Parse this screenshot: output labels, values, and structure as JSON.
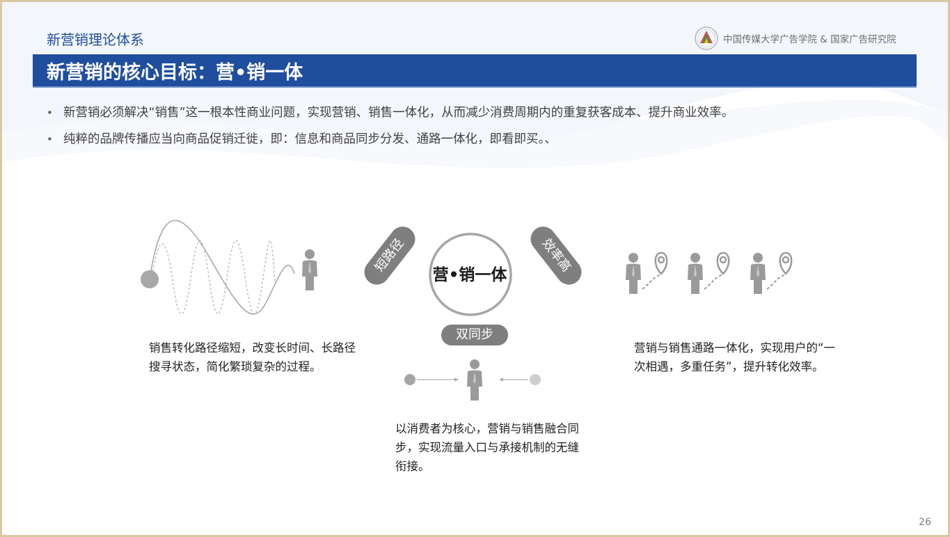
{
  "header": {
    "section_title": "新营销理论体系",
    "org_text": "中国传媒大学广告学院 & 国家广告研究院"
  },
  "title": "新营销的核心目标：营•销一体",
  "bullets": [
    "新营销必须解决“销售”这一根本性商业问题，实现营销、销售一体化，从而减少消费周期内的重复获客成本、提升商业效率。",
    "纯粹的品牌传播应当向商品促销迁徙，即：信息和商品同步分发、通路一体化，即看即买。、"
  ],
  "diagram": {
    "center_label": "营•销一体",
    "pill_left": "短路径",
    "pill_right": "效率高",
    "pill_bottom": "双同步",
    "desc_left": "销售转化路径缩短，改变长时间、长路径搜寻状态，简化繁琐复杂的过程。",
    "desc_mid": "以消费者为核心，营销与销售融合同步，实现流量入口与承接机制的无缝衔接。",
    "desc_right": "营销与销售通路一体化，实现用户的“一次相遇，多重任务”，提升转化效率。"
  },
  "colors": {
    "brand_blue": "#1f4e9e",
    "gray": "#7f7f7f",
    "frame": "#d9c9a3"
  },
  "page_number": "26"
}
